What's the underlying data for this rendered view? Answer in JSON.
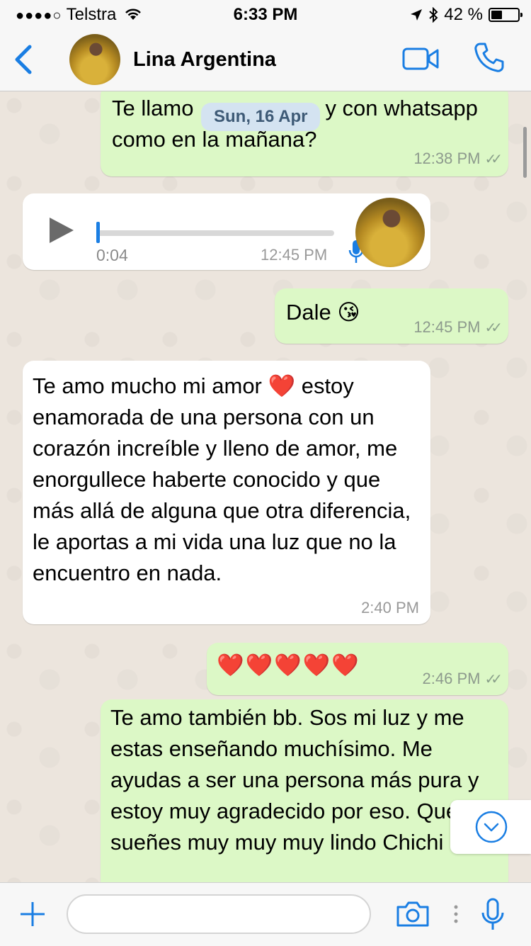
{
  "status_bar": {
    "signal": "●●●●○",
    "carrier": "Telstra",
    "time": "6:33 PM",
    "battery": "42 %",
    "battery_level": 0.42
  },
  "header": {
    "contact_name": "Lina Argentina"
  },
  "chat": {
    "date_pill": "Sun, 16 Apr",
    "messages": [
      {
        "text_a": "Te llamo",
        "text_b": "y con whatsapp",
        "text_c": "como en la mañana?",
        "time": "12:38 PM",
        "ticks": "✓✓"
      },
      {
        "duration": "0:04",
        "time": "12:45 PM",
        "progress": 0.0
      },
      {
        "text": "Dale 😘",
        "time": "12:45 PM",
        "ticks": "✓✓"
      },
      {
        "text": "Te amo mucho mi amor ❤️ estoy enamorada de una persona con un corazón increíble y lleno de amor, me enorgullece haberte conocido y que más allá de alguna que otra diferencia, le aportas a mi vida una luz que no la encuentro en nada.",
        "time": "2:40 PM"
      },
      {
        "text": "❤️❤️❤️❤️❤️",
        "time": "2:46 PM",
        "ticks": "✓✓"
      },
      {
        "text": "Te amo también bb. Sos mi luz y me estas enseñando muchísimo. Me ayudas a ser una persona más pura y estoy muy agradecido por eso. Que sueñes muy muy muy lindo Chichi ❤️"
      }
    ]
  },
  "input": {
    "placeholder": ""
  },
  "colors": {
    "accent": "#1a7ee3",
    "outgoing_bubble": "#dcf8c6",
    "incoming_bubble": "#ffffff",
    "chat_bg": "#ece5dd"
  },
  "icons": [
    "back-chevron-icon",
    "video-call-icon",
    "phone-icon",
    "play-icon",
    "microphone-icon",
    "plus-icon",
    "camera-icon",
    "more-dots-icon",
    "scroll-down-icon"
  ]
}
